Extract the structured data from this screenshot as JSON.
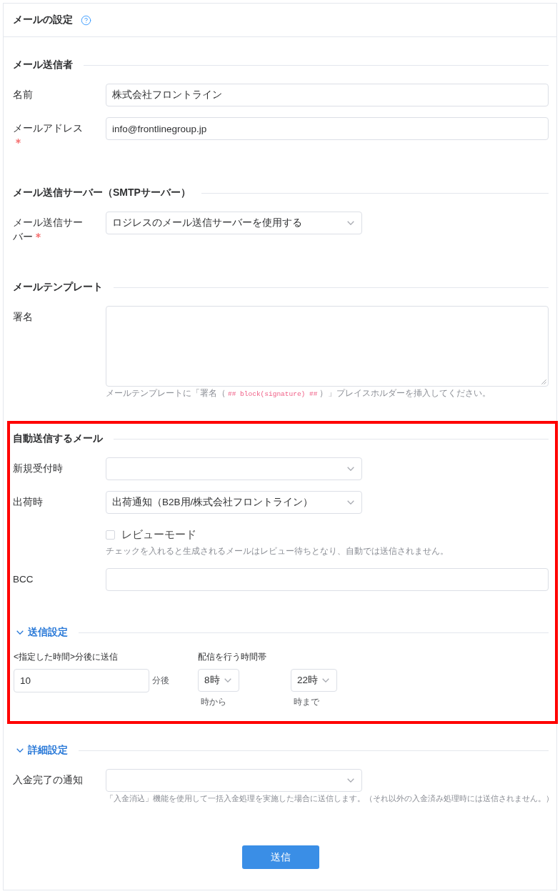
{
  "header": {
    "title": "メールの設定"
  },
  "sections": [
    {
      "kind": "plain",
      "title": "メール送信者",
      "highlighted": false,
      "fields": [
        {
          "kind": "text",
          "label": "名前",
          "value": "株式会社フロントライン",
          "required": false
        },
        {
          "kind": "text",
          "label": "メールアドレス",
          "value": "info@frontlinegroup.jp",
          "required": true
        }
      ]
    },
    {
      "kind": "plain",
      "title": "メール送信サーバー（SMTPサーバー）",
      "highlighted": false,
      "fields": [
        {
          "kind": "select",
          "label": "メール送信サーバー",
          "value": "ロジレスのメール送信サーバーを使用する",
          "required": true
        }
      ]
    },
    {
      "kind": "plain",
      "title": "メールテンプレート",
      "highlighted": false,
      "fields": [
        {
          "kind": "textarea",
          "label": "署名",
          "required": false,
          "help_parts": {
            "before": "メールテンプレートに「署名（",
            "code": "## block(signature) ##",
            "after": "）」プレイスホルダーを挿入してください。"
          }
        }
      ]
    },
    {
      "kind": "plain",
      "title": "自動送信するメール",
      "highlighted": true,
      "fields": [
        {
          "kind": "select",
          "label": "新規受付時",
          "required": false
        },
        {
          "kind": "select",
          "label": "出荷時",
          "value": "出荷通知（B2B用/株式会社フロントライン）",
          "required": false
        },
        {
          "kind": "checkbox",
          "label": "レビューモード",
          "checked": false,
          "help": "チェックを入れると生成されるメールはレビュー待ちとなり、自動では送信されません。"
        },
        {
          "kind": "text",
          "label": "BCC",
          "required": false
        }
      ],
      "subsection": {
        "title": "送信設定",
        "expanded": true,
        "delay": {
          "label": "<指定した時間>分後に送信",
          "value": "10",
          "unit": "分後"
        },
        "window": {
          "label": "配信を行う時間帯",
          "from": {
            "value": "8時",
            "caption": "時から"
          },
          "to": {
            "value": "22時",
            "caption": "時まで"
          }
        }
      }
    },
    {
      "kind": "collapsible",
      "title": "詳細設定",
      "highlighted": false,
      "expanded": true,
      "fields": [
        {
          "kind": "select",
          "label": "入金完了の通知",
          "required": false,
          "help": "「入金消込」機能を使用して一括入金処理を実施した場合に送信します。（それ以外の入金済み処理時には送信されません。）"
        }
      ]
    }
  ],
  "submit_button": {
    "label": "送信"
  }
}
